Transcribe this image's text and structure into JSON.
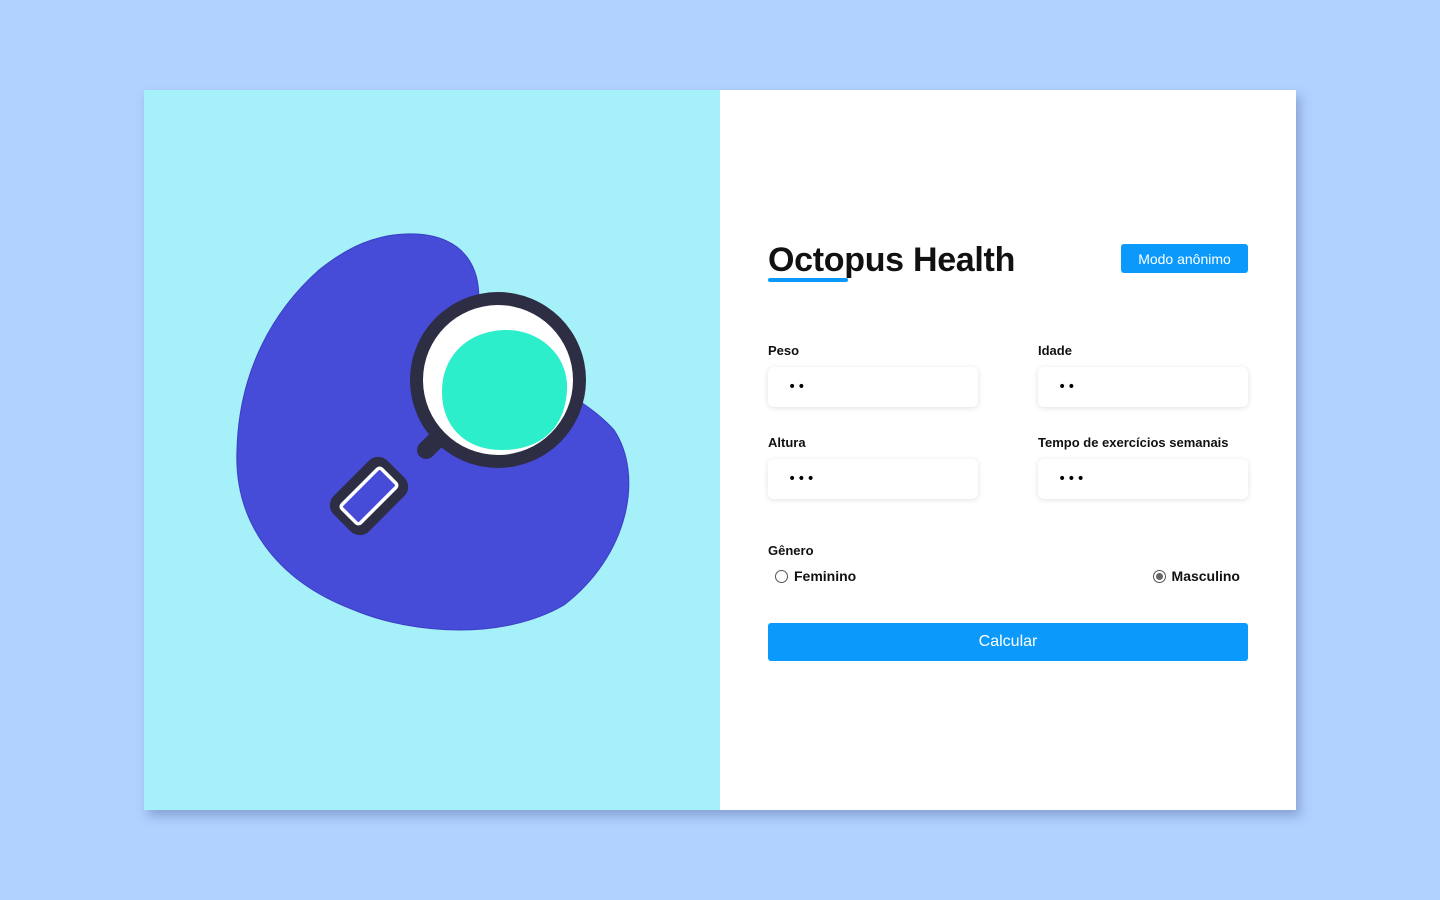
{
  "app": {
    "title": "Octopus Health",
    "anon_mode_label": "Modo anônimo"
  },
  "form": {
    "fields": {
      "peso": {
        "label": "Peso",
        "value": "••"
      },
      "idade": {
        "label": "Idade",
        "value": "••"
      },
      "altura": {
        "label": "Altura",
        "value": "•••"
      },
      "tempo": {
        "label": "Tempo de exercícios semanais",
        "value": "•••"
      }
    },
    "gender": {
      "label": "Gênero",
      "options": [
        {
          "label": "Feminino",
          "checked": false
        },
        {
          "label": "Masculino",
          "checked": true
        }
      ]
    },
    "submit_label": "Calcular"
  },
  "illustration": {
    "icon": "magnifying-glass-icon"
  },
  "colors": {
    "page_background": "#b1d1fe",
    "left_panel": "#a6f0fa",
    "blob": "#464bd8",
    "lens": "#2ceeca",
    "handle_outline": "#2d2d44",
    "accent": "#0b9afc"
  }
}
